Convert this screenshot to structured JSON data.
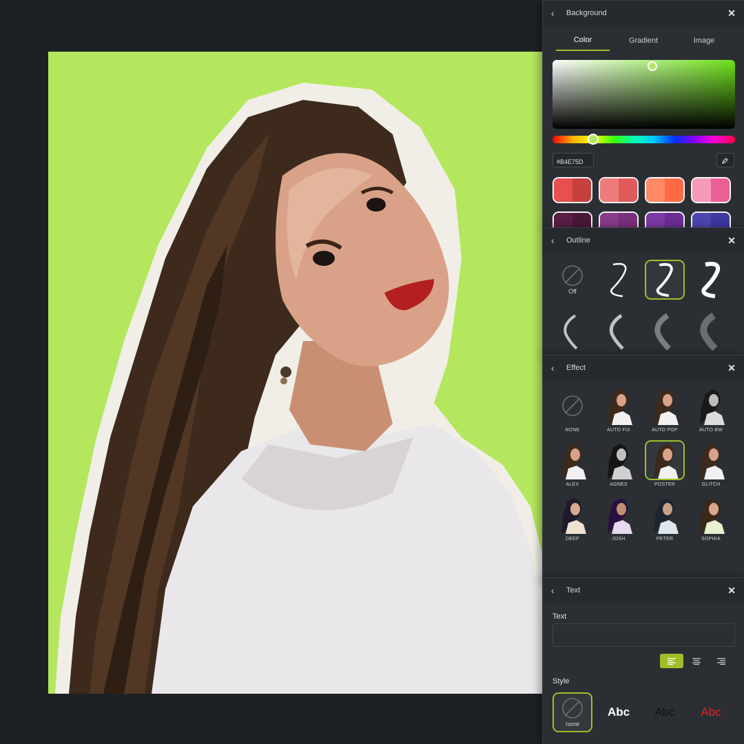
{
  "colors": {
    "accent": "#9fbf2a",
    "canvas_background": "#B4E75D",
    "panel_bg": "#2b2f34"
  },
  "background_panel": {
    "title": "Background",
    "tabs": [
      {
        "label": "Color",
        "active": true
      },
      {
        "label": "Gradient",
        "active": false
      },
      {
        "label": "Image",
        "active": false
      }
    ],
    "hex_value": "#B4E75D",
    "swatches": [
      [
        "#e7504f",
        "#c6403f"
      ],
      [
        "#ee7b7b",
        "#e05a5a"
      ],
      [
        "#ff8a64",
        "#ff6a45"
      ],
      [
        "#f59ab8",
        "#ea5f95"
      ],
      [
        "#5a1f45",
        "#4a1837"
      ],
      [
        "#8a3b8a",
        "#7a2f7a"
      ],
      [
        "#7d3aa6",
        "#6a2d94"
      ],
      [
        "#4d46b0",
        "#3e38a0"
      ]
    ]
  },
  "outline_panel": {
    "title": "Outline",
    "off_label": "Off"
  },
  "effect_panel": {
    "title": "Effect",
    "effects": [
      "NONE",
      "AUTO FIX",
      "AUTO POP",
      "AUTO BW",
      "ALEX",
      "AGNES",
      "POSTER",
      "GLITCH",
      "DEEP",
      "JOSH",
      "PETER",
      "SOPHIA"
    ]
  },
  "text_panel": {
    "title": "Text",
    "text_label": "Text",
    "text_value": "",
    "style_label": "Style",
    "style_none_label": "none",
    "style_sample": "Abc"
  }
}
